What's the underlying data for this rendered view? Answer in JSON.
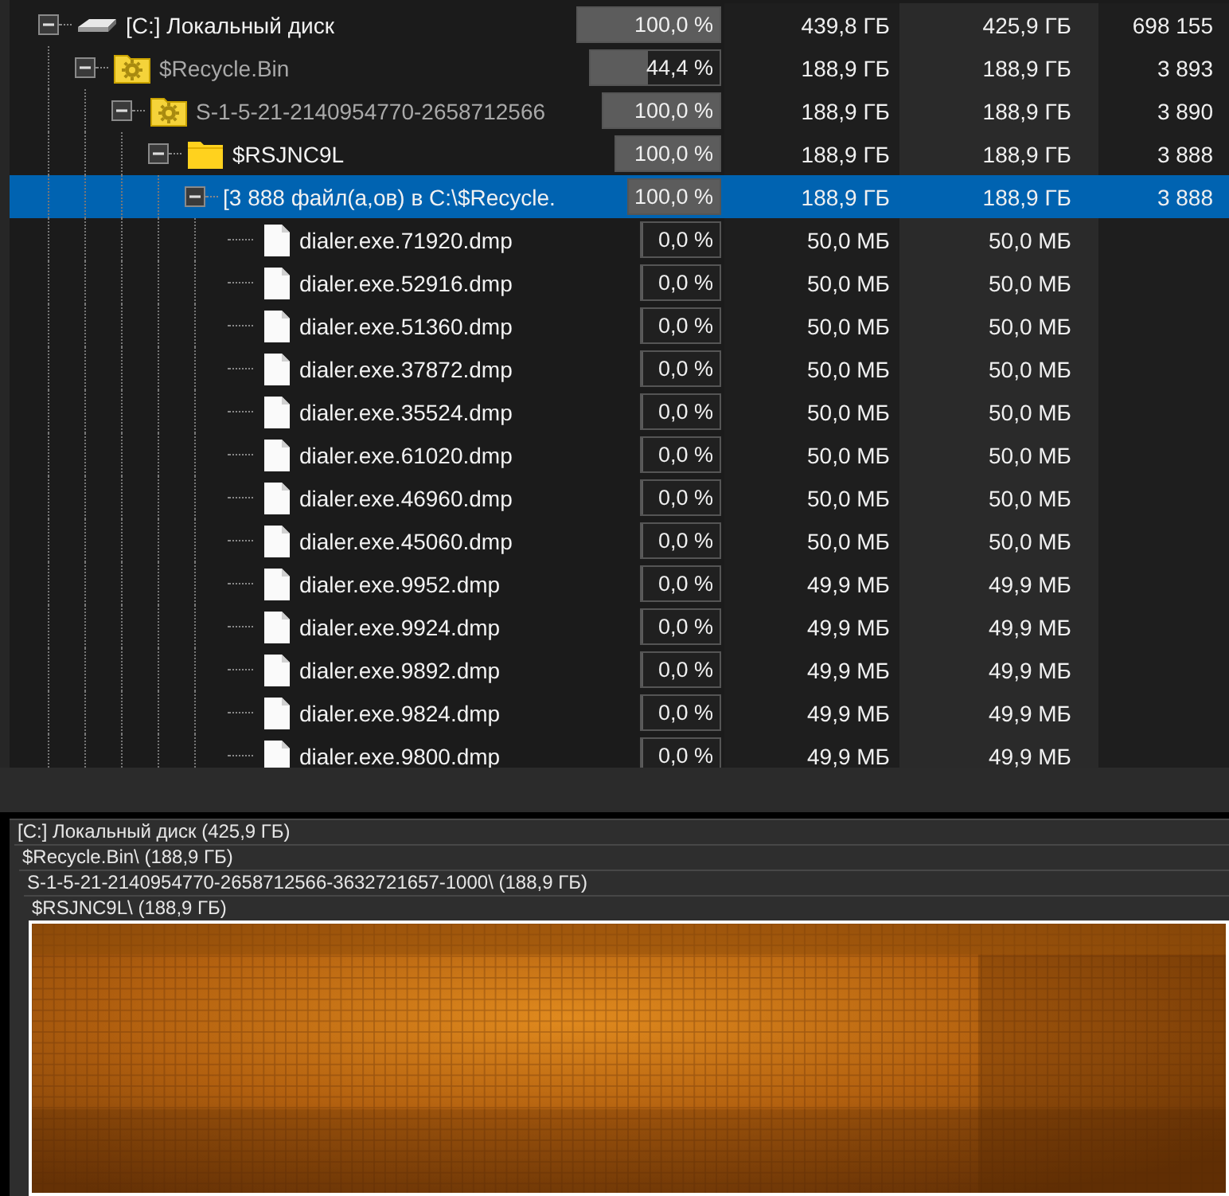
{
  "tree": [
    {
      "kind": "drive",
      "name": "[C:] Локальный диск",
      "dimmed": false,
      "expanded": true,
      "selected": false,
      "level": 1,
      "percent": "100,0 %",
      "size": "439,8 ГБ",
      "allocated": "425,9 ГБ",
      "items": "698 155",
      "children": [
        {
          "kind": "system-folder",
          "name": "$Recycle.Bin",
          "dimmed": true,
          "expanded": true,
          "selected": false,
          "level": 0.444,
          "percent": "44,4 %",
          "size": "188,9 ГБ",
          "allocated": "188,9 ГБ",
          "items": "3 893",
          "children": [
            {
              "kind": "system-folder",
              "name": "S-1-5-21-2140954770-2658712566",
              "dimmed": true,
              "expanded": true,
              "selected": false,
              "level": 1,
              "percent": "100,0 %",
              "size": "188,9 ГБ",
              "allocated": "188,9 ГБ",
              "items": "3 890",
              "children": [
                {
                  "kind": "folder",
                  "name": "$RSJNC9L",
                  "dimmed": false,
                  "expanded": true,
                  "selected": false,
                  "level": 1,
                  "percent": "100,0 %",
                  "size": "188,9 ГБ",
                  "allocated": "188,9 ГБ",
                  "items": "3 888",
                  "children": [
                    {
                      "name": "[3 888 файл(а,ов) в C:\\$Recycle.",
                      "dimmed": false,
                      "expanded": true,
                      "selected": true,
                      "level": 1,
                      "percent": "100,0 %",
                      "size": "188,9 ГБ",
                      "allocated": "188,9 ГБ",
                      "items": "3 888",
                      "children": [
                        {
                          "kind": "file",
                          "name": "dialer.exe.71920.dmp",
                          "dimmed": false,
                          "selected": false,
                          "level": 0,
                          "percent": "0,0 %",
                          "size": "50,0 МБ",
                          "allocated": "50,0 МБ"
                        },
                        {
                          "kind": "file",
                          "name": "dialer.exe.52916.dmp",
                          "dimmed": false,
                          "selected": false,
                          "level": 0,
                          "percent": "0,0 %",
                          "size": "50,0 МБ",
                          "allocated": "50,0 МБ"
                        },
                        {
                          "kind": "file",
                          "name": "dialer.exe.51360.dmp",
                          "dimmed": false,
                          "selected": false,
                          "level": 0,
                          "percent": "0,0 %",
                          "size": "50,0 МБ",
                          "allocated": "50,0 МБ"
                        },
                        {
                          "kind": "file",
                          "name": "dialer.exe.37872.dmp",
                          "dimmed": false,
                          "selected": false,
                          "level": 0,
                          "percent": "0,0 %",
                          "size": "50,0 МБ",
                          "allocated": "50,0 МБ"
                        },
                        {
                          "kind": "file",
                          "name": "dialer.exe.35524.dmp",
                          "dimmed": false,
                          "selected": false,
                          "level": 0,
                          "percent": "0,0 %",
                          "size": "50,0 МБ",
                          "allocated": "50,0 МБ"
                        },
                        {
                          "kind": "file",
                          "name": "dialer.exe.61020.dmp",
                          "dimmed": false,
                          "selected": false,
                          "level": 0,
                          "percent": "0,0 %",
                          "size": "50,0 МБ",
                          "allocated": "50,0 МБ"
                        },
                        {
                          "kind": "file",
                          "name": "dialer.exe.46960.dmp",
                          "dimmed": false,
                          "selected": false,
                          "level": 0,
                          "percent": "0,0 %",
                          "size": "50,0 МБ",
                          "allocated": "50,0 МБ"
                        },
                        {
                          "kind": "file",
                          "name": "dialer.exe.45060.dmp",
                          "dimmed": false,
                          "selected": false,
                          "level": 0,
                          "percent": "0,0 %",
                          "size": "50,0 МБ",
                          "allocated": "50,0 МБ"
                        },
                        {
                          "kind": "file",
                          "name": "dialer.exe.9952.dmp",
                          "dimmed": false,
                          "selected": false,
                          "level": 0,
                          "percent": "0,0 %",
                          "size": "49,9 МБ",
                          "allocated": "49,9 МБ"
                        },
                        {
                          "kind": "file",
                          "name": "dialer.exe.9924.dmp",
                          "dimmed": false,
                          "selected": false,
                          "level": 0,
                          "percent": "0,0 %",
                          "size": "49,9 МБ",
                          "allocated": "49,9 МБ"
                        },
                        {
                          "kind": "file",
                          "name": "dialer.exe.9892.dmp",
                          "dimmed": false,
                          "selected": false,
                          "level": 0,
                          "percent": "0,0 %",
                          "size": "49,9 МБ",
                          "allocated": "49,9 МБ"
                        },
                        {
                          "kind": "file",
                          "name": "dialer.exe.9824.dmp",
                          "dimmed": false,
                          "selected": false,
                          "level": 0,
                          "percent": "0,0 %",
                          "size": "49,9 МБ",
                          "allocated": "49,9 МБ"
                        },
                        {
                          "kind": "file",
                          "name": "dialer.exe.9800.dmp",
                          "dimmed": false,
                          "selected": false,
                          "level": 0,
                          "percent": "0,0 %",
                          "size": "49,9 МБ",
                          "allocated": "49,9 МБ"
                        }
                      ]
                    }
                  ]
                }
              ]
            }
          ]
        }
      ]
    }
  ],
  "treemap": {
    "path": [
      {
        "label": "[C:] Локальный диск  (425,9 ГБ)",
        "children": [
          {
            "label": "$Recycle.Bin\\ (188,9 ГБ)",
            "children": [
              {
                "label": "S-1-5-21-2140954770-2658712566-3632721657-1000\\ (188,9 ГБ)",
                "children": [
                  {
                    "label": "$RSJNC9L\\ (188,9 ГБ)"
                  }
                ]
              }
            ]
          }
        ]
      }
    ]
  }
}
